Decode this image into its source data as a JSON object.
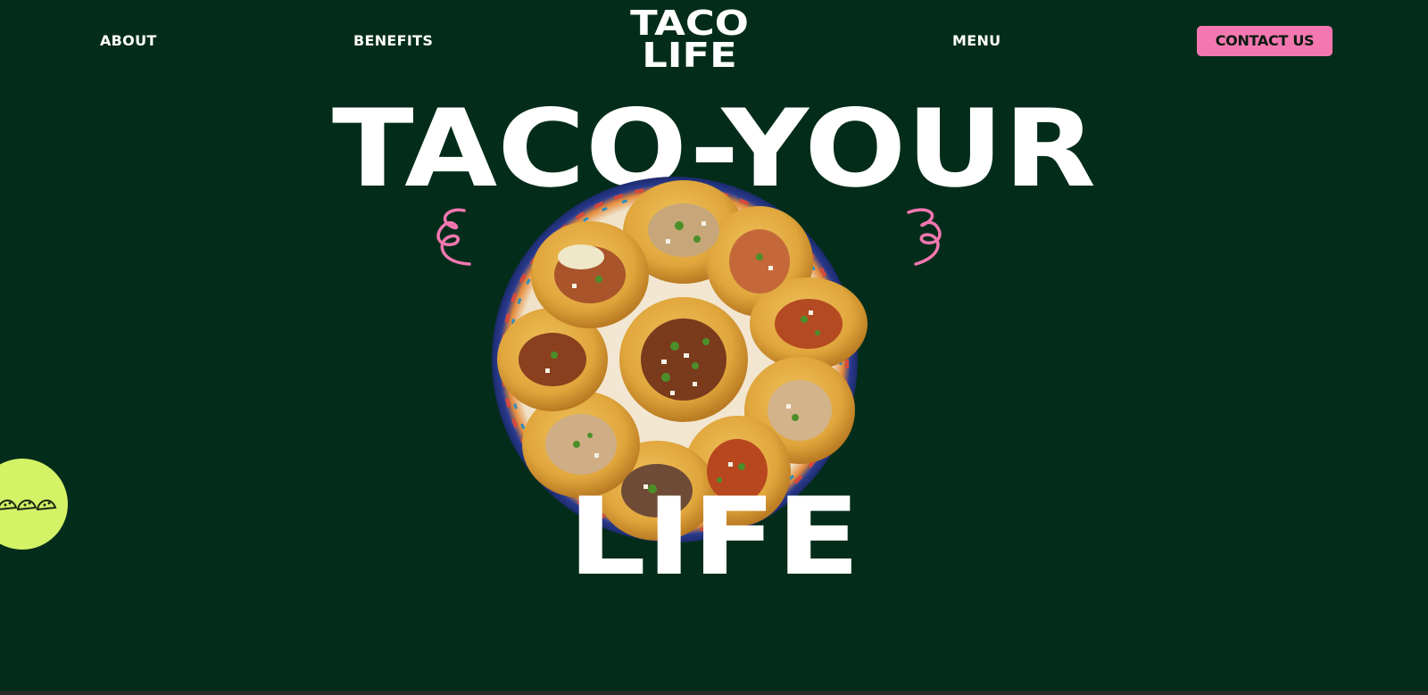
{
  "nav": {
    "about": "ABOUT",
    "benefits": "BENEFITS",
    "logo_line1": "TACO",
    "logo_line2": "LIFE",
    "menu": "MENU",
    "contact": "CONTACT US"
  },
  "hero": {
    "headline_top": "TACO-YOUR",
    "headline_bottom": "LIFE",
    "image_description": "plate-of-tacos",
    "squiggle_icon": "pink-squiggle-icon"
  },
  "badge": {
    "icon": "tacos-icon"
  },
  "colors": {
    "background": "#032d1a",
    "accent_pink": "#f477b0",
    "accent_lime": "#d4f266",
    "text": "#ffffff"
  }
}
